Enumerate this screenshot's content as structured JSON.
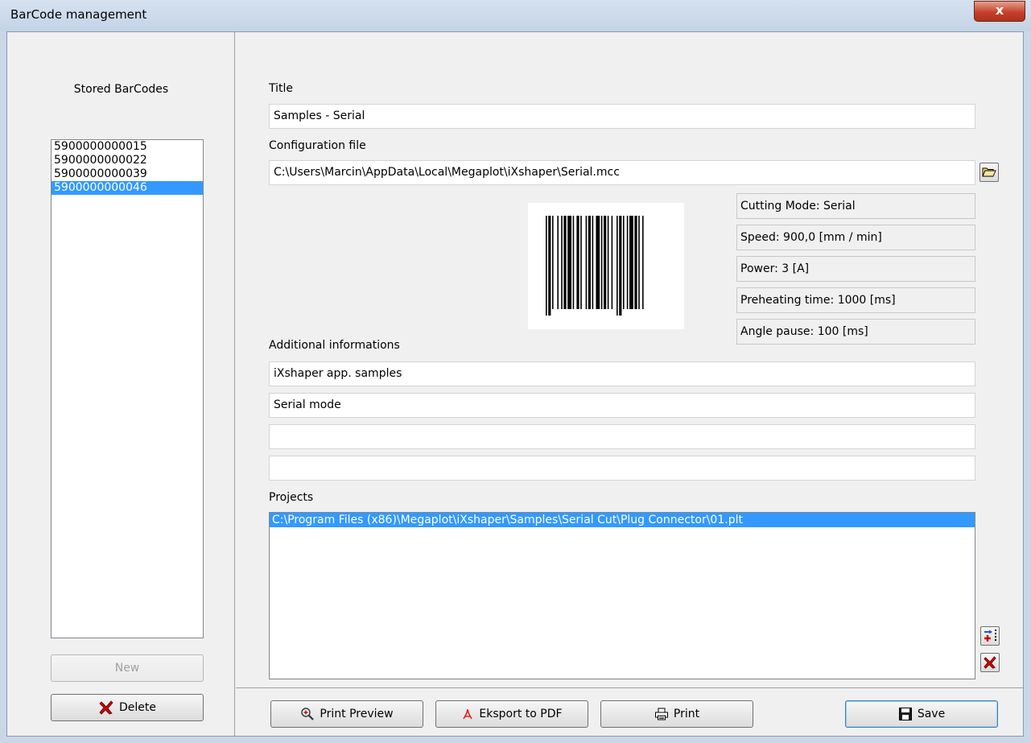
{
  "window": {
    "title": "BarCode management",
    "close_glyph": "x"
  },
  "left": {
    "stored_label": "Stored BarCodes",
    "barcodes": [
      "5900000000015",
      "5900000000022",
      "5900000000039",
      "5900000000046"
    ],
    "selected_index": 3,
    "new_label": "New",
    "delete_label": "Delete"
  },
  "form": {
    "title_label": "Title",
    "title_value": "Samples - Serial",
    "config_label": "Configuration file",
    "config_value": "C:\\Users\\Marcin\\AppData\\Local\\Megaplot\\iXshaper\\Serial.mcc",
    "info": [
      "Cutting Mode: Serial",
      "Speed: 900,0 [mm / min]",
      "Power: 3 [A]",
      "Preheating time: 1000 [ms]",
      "Angle pause: 100 [ms]"
    ],
    "additional_label": "Additional informations",
    "additional": [
      "iXshaper app. samples",
      "Serial mode",
      "",
      ""
    ],
    "projects_label": "Projects",
    "projects": [
      "C:\\Program Files (x86)\\Megaplot\\iXshaper\\Samples\\Serial Cut\\Plug Connector\\01.plt"
    ]
  },
  "buttons": {
    "print_preview": "Print Preview",
    "export_pdf": "Eksport to PDF",
    "print": "Print",
    "save": "Save"
  },
  "icons": {
    "browse": "folder-open-icon",
    "add_project": "add-project-icon",
    "remove_project": "red-x-icon",
    "delete": "red-x-icon",
    "print_preview": "magnifier-icon",
    "export_pdf": "pdf-icon",
    "print": "printer-icon",
    "save": "floppy-disk-icon"
  },
  "colors": {
    "selection": "#3399ff",
    "delete_x": "#cc0000",
    "window_frame": "#c9d7e8"
  }
}
